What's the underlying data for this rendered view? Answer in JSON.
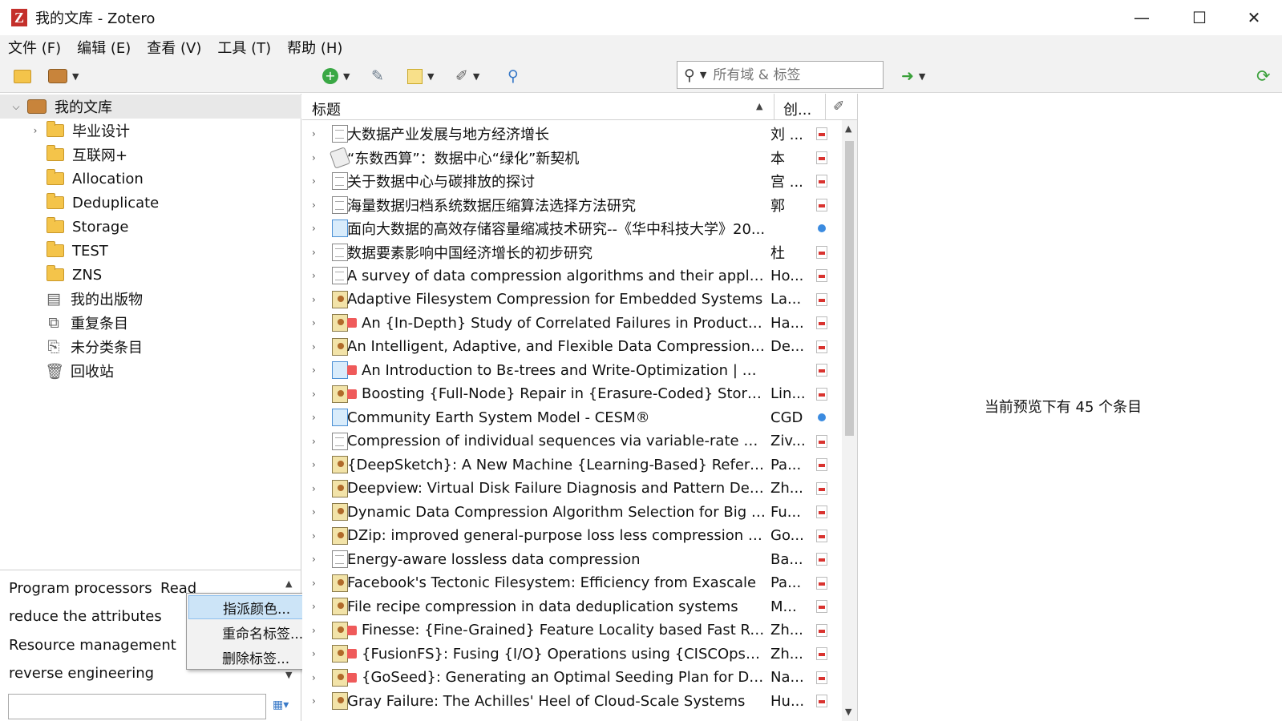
{
  "window": {
    "title": "我的文库 - Zotero",
    "logo": "Z"
  },
  "window_controls": {
    "minimize": "—",
    "maximize": "☐",
    "close": "✕"
  },
  "menu": [
    "文件 (F)",
    "编辑 (E)",
    "查看 (V)",
    "工具 (T)",
    "帮助 (H)"
  ],
  "search": {
    "placeholder": "所有域 & 标签"
  },
  "toolbar_icons": [
    "new-collection-icon",
    "new-library-icon",
    "new-item-icon",
    "add-by-identifier-icon",
    "new-note-icon",
    "attachment-icon",
    "advanced-search-icon",
    "locate-icon",
    "sync-icon"
  ],
  "collections": [
    {
      "label": "我的文库",
      "type": "library",
      "expanded": true
    },
    {
      "label": "毕业设计",
      "type": "folder",
      "has_children": true
    },
    {
      "label": "互联网+",
      "type": "folder"
    },
    {
      "label": "Allocation",
      "type": "folder"
    },
    {
      "label": "Deduplicate",
      "type": "folder"
    },
    {
      "label": "Storage",
      "type": "folder"
    },
    {
      "label": "TEST",
      "type": "folder"
    },
    {
      "label": "ZNS",
      "type": "folder"
    },
    {
      "label": "我的出版物",
      "type": "publications"
    },
    {
      "label": "重复条目",
      "type": "duplicates"
    },
    {
      "label": "未分类条目",
      "type": "unfiled"
    },
    {
      "label": "回收站",
      "type": "trash"
    }
  ],
  "tags": [
    {
      "label": "Program processors"
    },
    {
      "label": "Read"
    },
    {
      "label": "reduce the attributes"
    },
    {
      "label": "Resource management"
    },
    {
      "label": "reverse engineering"
    }
  ],
  "context_menu": [
    "指派颜色...",
    "重命名标签...",
    "删除标签..."
  ],
  "columns": {
    "title": "标题",
    "creator": "创..."
  },
  "items": [
    {
      "title": "大数据产业发展与地方经济增长",
      "creator": "刘 ...",
      "icon": "doc",
      "tagged": false,
      "attachment": "pdf"
    },
    {
      "title": "“东数西算”：数据中心“绿化”新契机",
      "creator": "本",
      "icon": "report",
      "tagged": false,
      "attachment": "pdf"
    },
    {
      "title": "关于数据中心与碳排放的探讨",
      "creator": "宫 ...",
      "icon": "doc",
      "tagged": false,
      "attachment": "pdf"
    },
    {
      "title": "海量数据归档系统数据压缩算法选择方法研究",
      "creator": "郭",
      "icon": "doc",
      "tagged": false,
      "attachment": "pdf"
    },
    {
      "title": "面向大数据的高效存储容量缩减技术研究--《华中科技大学》20...",
      "creator": "",
      "icon": "web",
      "tagged": false,
      "attachment": "link"
    },
    {
      "title": "数据要素影响中国经济增长的初步研究",
      "creator": "杜",
      "icon": "doc",
      "tagged": false,
      "attachment": "pdf"
    },
    {
      "title": "A survey of data compression algorithms and their applica...",
      "creator": "Ho...",
      "icon": "doc",
      "tagged": false,
      "attachment": "pdf"
    },
    {
      "title": "Adaptive Filesystem Compression for Embedded Systems",
      "creator": "La...",
      "icon": "conf",
      "tagged": false,
      "attachment": "pdf"
    },
    {
      "title": "An {In-Depth} Study of Correlated Failures in Production ...",
      "creator": "Ha...",
      "icon": "conf",
      "tagged": true,
      "attachment": "pdf"
    },
    {
      "title": "An Intelligent, Adaptive, and Flexible Data Compression Fr...",
      "creator": "De...",
      "icon": "conf",
      "tagged": false,
      "attachment": "pdf"
    },
    {
      "title": "An Introduction to Bε-trees and Write-Optimization | US...",
      "creator": "",
      "icon": "web",
      "tagged": true,
      "attachment": "pdf"
    },
    {
      "title": "Boosting {Full-Node} Repair in {Erasure-Coded} Storage",
      "creator": "Lin...",
      "icon": "conf",
      "tagged": true,
      "attachment": "pdf"
    },
    {
      "title": "Community Earth System Model - CESM®",
      "creator": "CGD",
      "icon": "web",
      "tagged": false,
      "attachment": "link"
    },
    {
      "title": "Compression of individual sequences via variable-rate codi...",
      "creator": "Ziv...",
      "icon": "doc",
      "tagged": false,
      "attachment": "pdf"
    },
    {
      "title": "{DeepSketch}: A New Machine {Learning-Based} Reference...",
      "creator": "Pa...",
      "icon": "conf",
      "tagged": false,
      "attachment": "pdf"
    },
    {
      "title": "Deepview: Virtual Disk Failure Diagnosis and Pattern Detec...",
      "creator": "Zh...",
      "icon": "conf",
      "tagged": false,
      "attachment": "pdf"
    },
    {
      "title": "Dynamic Data Compression Algorithm Selection for Big Da...",
      "creator": "Fu...",
      "icon": "conf",
      "tagged": false,
      "attachment": "pdf"
    },
    {
      "title": "DZip: improved general-purpose loss less compression ba...",
      "creator": "Go...",
      "icon": "conf",
      "tagged": false,
      "attachment": "pdf"
    },
    {
      "title": "Energy-aware lossless data compression",
      "creator": "Ba...",
      "icon": "doc",
      "tagged": false,
      "attachment": "pdf"
    },
    {
      "title": "Facebook's Tectonic Filesystem: Efficiency from Exascale",
      "creator": "Pa...",
      "icon": "conf",
      "tagged": false,
      "attachment": "pdf"
    },
    {
      "title": "File recipe compression in data deduplication systems",
      "creator": "M...",
      "icon": "conf",
      "tagged": false,
      "attachment": "pdf"
    },
    {
      "title": "Finesse: {Fine-Grained} Feature Locality based Fast Rese...",
      "creator": "Zh...",
      "icon": "conf",
      "tagged": true,
      "attachment": "pdf"
    },
    {
      "title": "{FusionFS}: Fusing {I/O} Operations using {CISCOps} in Fi...",
      "creator": "Zh...",
      "icon": "conf",
      "tagged": true,
      "attachment": "pdf"
    },
    {
      "title": "{GoSeed}: Generating an Optimal Seeding Plan for Dedu...",
      "creator": "Na...",
      "icon": "conf",
      "tagged": true,
      "attachment": "pdf"
    },
    {
      "title": "Gray Failure: The Achilles' Heel of Cloud-Scale Systems",
      "creator": "Hu...",
      "icon": "conf",
      "tagged": false,
      "attachment": "pdf"
    }
  ],
  "preview": {
    "message": "当前预览下有 45 个条目"
  },
  "colors": {
    "tag_red": "#ef5a5a",
    "selection": "#cce4f7",
    "chrome": "#f2f2f2"
  }
}
